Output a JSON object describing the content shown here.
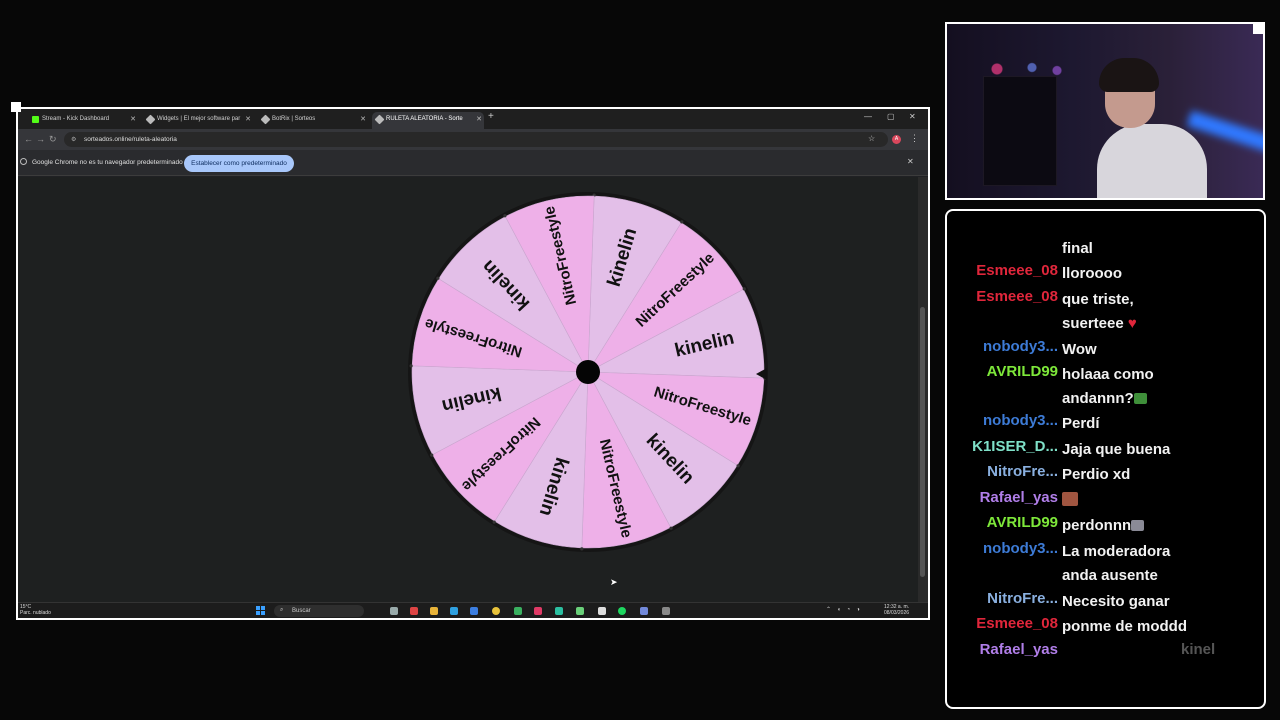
{
  "browser": {
    "tabs": [
      {
        "label": "Stream - Kick Dashboard",
        "color": "#53fc18"
      },
      {
        "label": "Widgets | El mejor software par",
        "color": "#bbbbbb"
      },
      {
        "label": "BotRix | Sorteos",
        "color": "#bbbbbb"
      },
      {
        "label": "RULETA ALEATORIA - Sorte",
        "color": "#bbbbbb"
      }
    ],
    "url": "sorteados.online/ruleta-aleatoria",
    "infobar": {
      "message": "Google Chrome no es tu navegador predeterminado",
      "button": "Establecer como predeterminado"
    },
    "profile_initial": "A",
    "taskbar": {
      "weather": "15°C",
      "weather_sub": "Parc. nublado",
      "search_placeholder": "Buscar",
      "time": "12:32 a. m.",
      "date": "08/03/2026"
    }
  },
  "wheel": {
    "segments": [
      "kinelin",
      "NitroFreestyle",
      "kinelin",
      "NitroFreestyle",
      "kinelin",
      "NitroFreestyle",
      "kinelin",
      "NitroFreestyle",
      "kinelin",
      "NitroFreestyle",
      "kinelin",
      "NitroFreestyle"
    ],
    "colors": [
      "#e3bfe8",
      "#eeb0e8"
    ]
  },
  "chat": {
    "messages": [
      {
        "user": "",
        "user_color": "#ffffff",
        "text": "final"
      },
      {
        "user": "Esmeee_08",
        "user_color": "#e0263b",
        "text": "lloroooo"
      },
      {
        "user": "Esmeee_08",
        "user_color": "#e0263b",
        "text": "que triste, suerteee",
        "heart": "♥"
      },
      {
        "user": "nobody3...",
        "user_color": "#3d7bd6",
        "text": "Wow"
      },
      {
        "user": "AVRILD99",
        "user_color": "#7ee83a",
        "text": "holaaa como andannn?",
        "emote": "#3f8f3a"
      },
      {
        "user": "nobody3...",
        "user_color": "#3d7bd6",
        "text": "Perdí"
      },
      {
        "user": "K1ISER_D...",
        "user_color": "#7fe0c8",
        "text": "Jaja que buena"
      },
      {
        "user": "NitroFre...",
        "user_color": "#8ab0e0",
        "text": "Perdio xd"
      },
      {
        "user": "Rafael_yas",
        "user_color": "#b07ee8",
        "text": "",
        "emote": "#a05540"
      },
      {
        "user": "AVRILD99",
        "user_color": "#7ee83a",
        "text": "perdonnn",
        "emote": "#8a8a96"
      },
      {
        "user": "nobody3...",
        "user_color": "#3d7bd6",
        "text": "La moderadora anda ausente"
      },
      {
        "user": "NitroFre...",
        "user_color": "#8ab0e0",
        "text": "Necesito ganar"
      },
      {
        "user": "Esmeee_08",
        "user_color": "#e0263b",
        "text": "ponme de moddd"
      },
      {
        "user": "Rafael_yas",
        "user_color": "#b07ee8",
        "text": "",
        "ghost": "kinel"
      }
    ]
  }
}
